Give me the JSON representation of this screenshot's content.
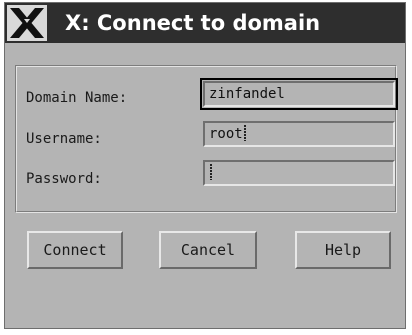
{
  "window": {
    "title": "X: Connect to domain",
    "logo_icon": "x-window-system-logo"
  },
  "form": {
    "domain": {
      "label": "Domain Name:",
      "value": "zinfandel"
    },
    "username": {
      "label": "Username:",
      "value": "root"
    },
    "password": {
      "label": "Password:",
      "value": ""
    }
  },
  "buttons": {
    "connect": "Connect",
    "cancel": "Cancel",
    "help": "Help"
  },
  "colors": {
    "window_bg": "#b4b4b4",
    "titlebar_bg": "#2e2e2e",
    "title_text": "#ffffff"
  }
}
